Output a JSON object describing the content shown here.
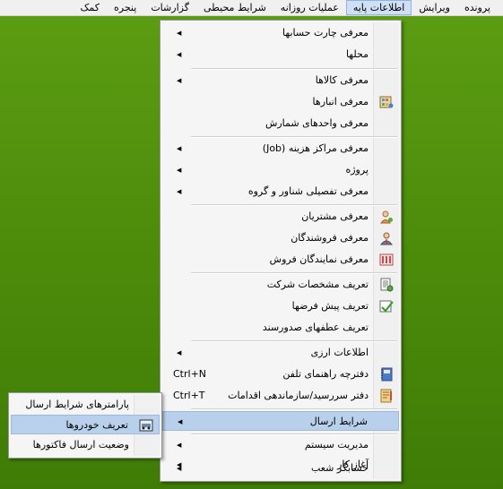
{
  "menubar": {
    "items": [
      {
        "label": "پرونده"
      },
      {
        "label": "ویرایش"
      },
      {
        "label": "اطلاعات پایه"
      },
      {
        "label": "عملیات روزانه"
      },
      {
        "label": "شرایط محیطی"
      },
      {
        "label": "گزارشات"
      },
      {
        "label": "پنجره"
      },
      {
        "label": "کمک"
      }
    ]
  },
  "main_menu": {
    "items": [
      {
        "label": "معرفی چارت حسابها",
        "submenu": true
      },
      {
        "label": "محلها",
        "submenu": true
      },
      {
        "label": "معرفی کالاها",
        "submenu": true
      },
      {
        "label": "معرفی انبارها",
        "icon": "warehouse-icon"
      },
      {
        "label": "معرفی  واحدهای شمارش"
      },
      {
        "label": "معرفی مراکز هزینه (Job)",
        "submenu": true
      },
      {
        "label": "پروژه",
        "submenu": true
      },
      {
        "label": "معرفی تفصیلی شناور و گروه",
        "submenu": true
      },
      {
        "label": "معرفی مشتریان",
        "icon": "customers-icon"
      },
      {
        "label": "معرفی فروشندگان",
        "icon": "vendors-icon"
      },
      {
        "label": "معرفی نمایندگان فروش",
        "icon": "sales-agents-icon"
      },
      {
        "label": "تعریف مشخصات شرکت",
        "icon": "company-info-icon"
      },
      {
        "label": "تعریف پیش فرضها",
        "icon": "defaults-check-icon"
      },
      {
        "label": "تعریف عطفهای صدورسند"
      },
      {
        "label": "اطلاعات ارزی",
        "submenu": true
      },
      {
        "label": "دفترچه راهنمای تلفن",
        "icon": "phonebook-icon",
        "shortcut": "Ctrl+N"
      },
      {
        "label": "دفتر سررسید/سازماندهی اقدامات",
        "icon": "planner-icon",
        "shortcut": "Ctrl+T"
      },
      {
        "label": "شرایط ارسال",
        "submenu": true
      },
      {
        "label": "مدیریت سیستم",
        "submenu": true
      },
      {
        "label": "آغاز کار",
        "submenu": true
      },
      {
        "label": "حسابگر شعب",
        "submenu": true
      }
    ]
  },
  "sub_menu": {
    "items": [
      {
        "label": "پارامترهای شرایط ارسال"
      },
      {
        "label": "تعریف خودروها",
        "icon": "vehicle-icon"
      },
      {
        "label": "وضعیت ارسال فاکتورها"
      }
    ]
  },
  "colors": {
    "desktop": "#4f8f0c",
    "highlight": "#b8d0ec",
    "menu_bg": "#f5f5f5"
  }
}
